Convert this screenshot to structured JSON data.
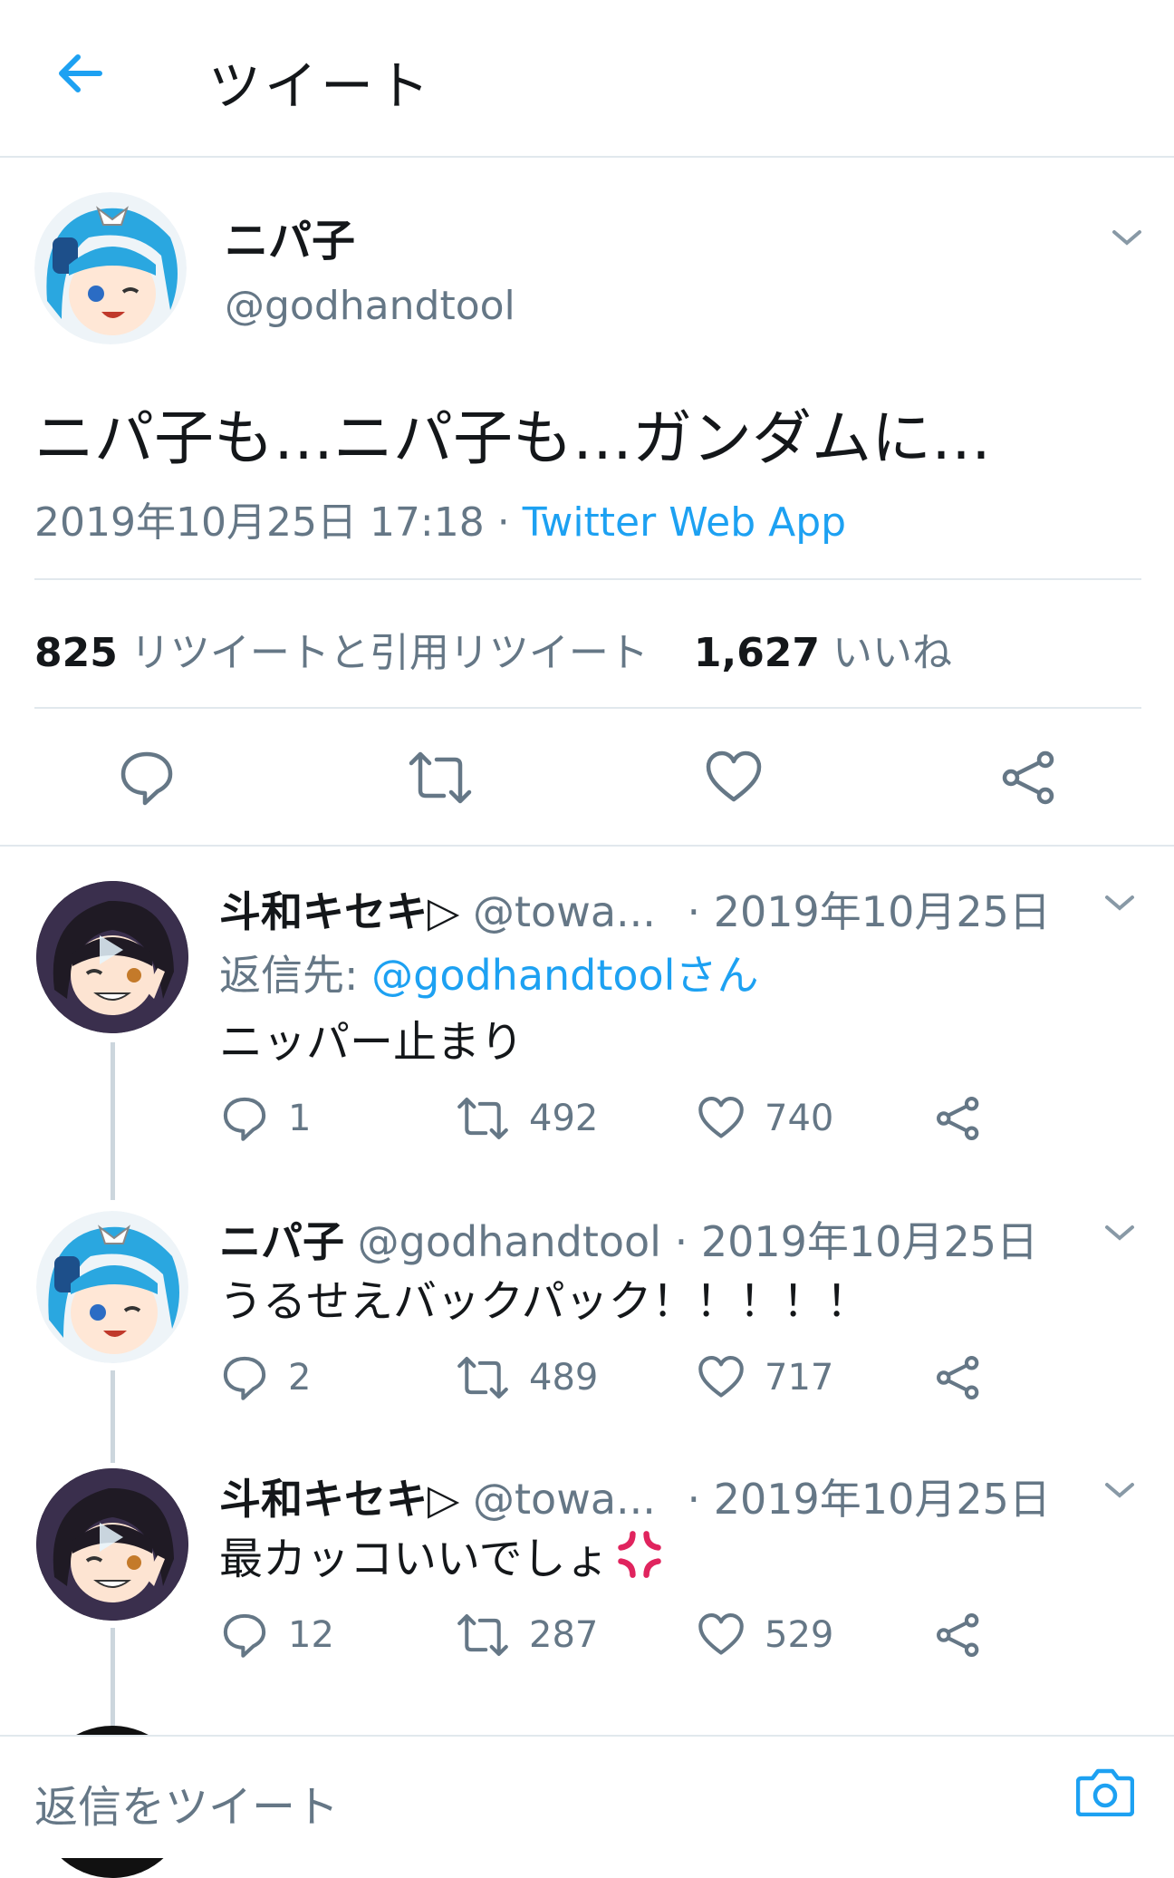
{
  "header": {
    "title": "ツイート",
    "back_icon": "arrow-left-icon"
  },
  "main_tweet": {
    "display_name": "ニパ子",
    "handle": "@godhandtool",
    "text": "ニパ子も…ニパ子も…ガンダムに…",
    "timestamp": "2019年10月25日 17:18",
    "separator": "·",
    "source": "Twitter Web App",
    "retweet_count": "825",
    "retweet_label": "リツイートと引用リツイート",
    "like_count": "1,627",
    "like_label": "いいね"
  },
  "replies": [
    {
      "display_name": "斗和キセキ▷",
      "handle": "@towa...",
      "date": "· 2019年10月25日",
      "reply_to_label": "返信先:",
      "reply_to_handle": "@godhandtoolさん",
      "text": "ニッパー止まり",
      "reply_count": "1",
      "retweet_count": "492",
      "like_count": "740"
    },
    {
      "display_name": "ニパ子",
      "handle": "@godhandtool",
      "date": "· 2019年10月25日",
      "text": "うるせえバックパック！！！！！",
      "reply_count": "2",
      "retweet_count": "489",
      "like_count": "717"
    },
    {
      "display_name": "斗和キセキ▷",
      "handle": "@towa...",
      "date": "· 2019年10月25日",
      "text": "最カッコいいでしょ",
      "emoji": "anger-symbol-icon",
      "reply_count": "12",
      "retweet_count": "287",
      "like_count": "529"
    }
  ],
  "reply_bar": {
    "placeholder": "返信をツイート",
    "camera_icon": "camera-icon"
  },
  "colors": {
    "accent": "#1da1f2",
    "secondary_text": "#657786",
    "divider": "#e1e8ed",
    "anger": "#e0245e"
  }
}
